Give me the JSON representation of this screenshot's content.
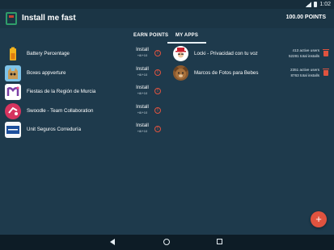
{
  "status": {
    "time": "1:02"
  },
  "appbar": {
    "title": "Install me fast",
    "points": "100.00 POINTS"
  },
  "tabs": [
    {
      "label": "EARN POINTS"
    },
    {
      "label": "MY APPS"
    }
  ],
  "earn_list": [
    {
      "name": "Battery Percentage",
      "action": "Install",
      "reward": "+8/+10",
      "icon": "battery-icon"
    },
    {
      "name": "Boxes appverture",
      "action": "Install",
      "reward": "+8/+10",
      "icon": "box-character-icon"
    },
    {
      "name": "Fiestas de la Región de Murcia",
      "action": "Install",
      "reward": "+8/+10",
      "icon": "m-letter-icon"
    },
    {
      "name": "Swoodle - Team Collaboration",
      "action": "Install",
      "reward": "+8/+10",
      "icon": "swoodle-icon"
    },
    {
      "name": "Unit Seguros Correduría",
      "action": "Install",
      "reward": "+8/+10",
      "icon": "unit-seguros-icon"
    }
  ],
  "my_apps": [
    {
      "name": "Locki - Privacidad con tu voz",
      "active": "413 active users",
      "total": "52281 total installs",
      "icon": "locki-icon"
    },
    {
      "name": "Marcos de Fotos para Bebes",
      "active": "2351 active users",
      "total": "8763 total installs",
      "icon": "bear-icon"
    }
  ],
  "fab": {
    "label": "+"
  },
  "colors": {
    "background": "#1e3a4c",
    "appbar": "#1b3545",
    "accent": "#e0533f",
    "navbar": "#0d1c26"
  }
}
